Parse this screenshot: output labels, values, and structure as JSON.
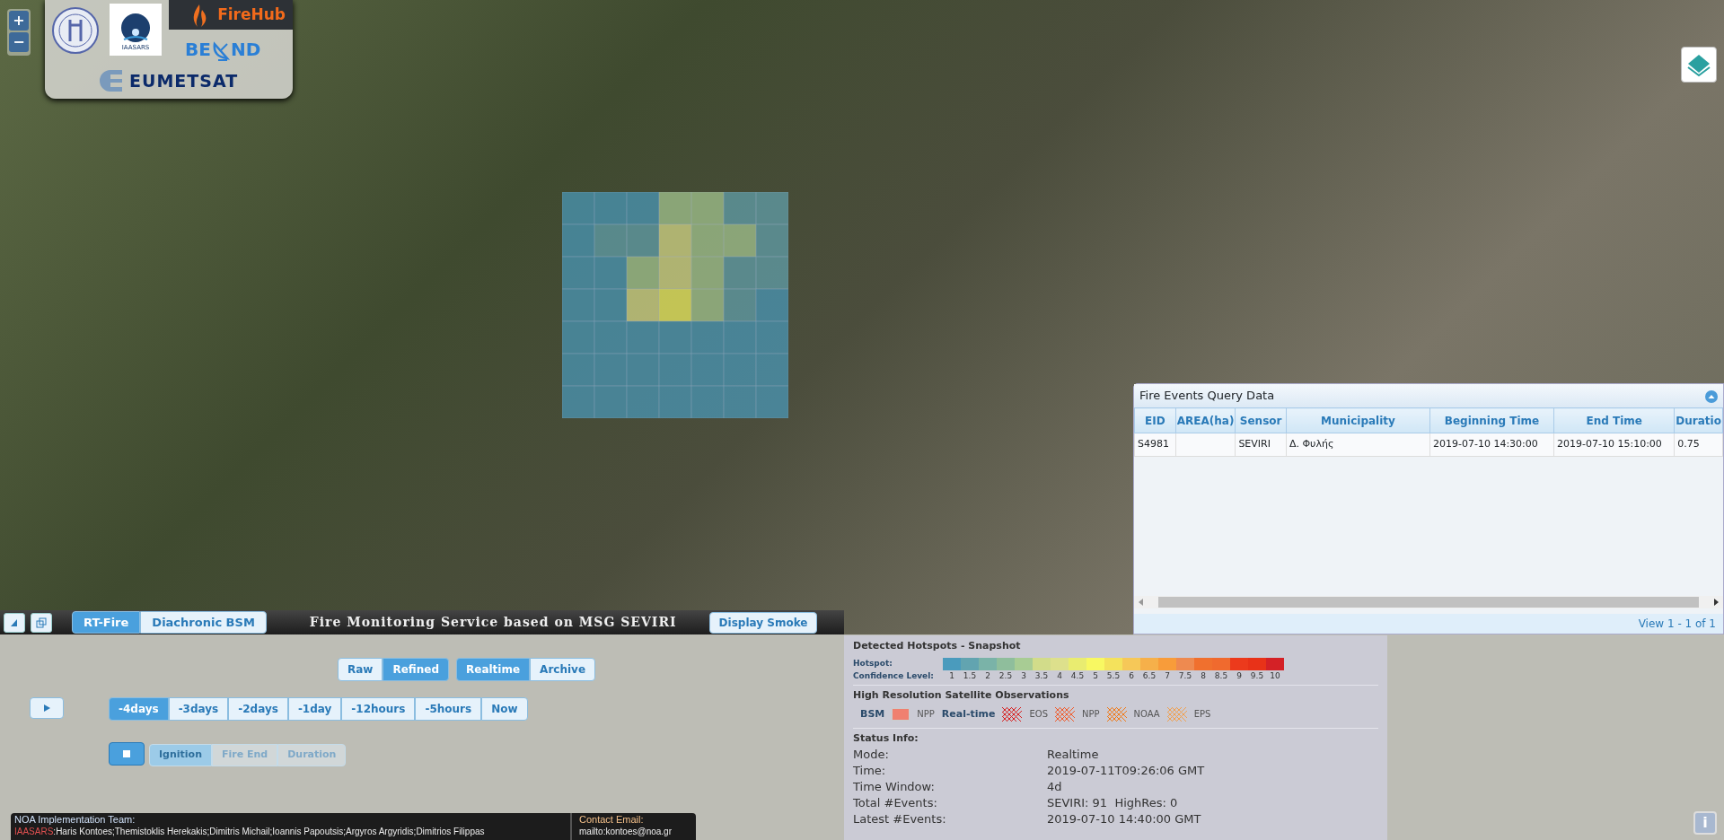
{
  "map_controls": {
    "zoom_in": "+",
    "zoom_out": "−"
  },
  "logos": {
    "iaasars": "IAASARS",
    "firehub": "FireHub",
    "beyond_left": "BE",
    "beyond_right": "ND",
    "eumetsat": "EUMETSAT"
  },
  "mode_tabs": [
    {
      "label": "RT-Fire",
      "selected": true
    },
    {
      "label": "Diachronic BSM",
      "selected": false
    }
  ],
  "banner": "Fire Monitoring Service based on MSG SEVIRI",
  "smoke_button": "Display Smoke",
  "query_panel": {
    "title": "Fire Events Query Data",
    "columns": [
      "EID",
      "AREA(ha)",
      "Sensor",
      "Municipality",
      "Beginning Time",
      "End Time",
      "Duratio"
    ],
    "rows": [
      [
        "S4981",
        "",
        "SEVIRI",
        "Δ. Φυλής",
        "2019-07-10 14:30:00",
        "2019-07-10 15:10:00",
        "0.75"
      ]
    ],
    "pager": "View 1 - 1 of 1"
  },
  "data_toggle": [
    {
      "label": "Raw",
      "selected": false
    },
    {
      "label": "Refined",
      "selected": true
    }
  ],
  "time_toggle": [
    {
      "label": "Realtime",
      "selected": true
    },
    {
      "label": "Archive",
      "selected": false
    }
  ],
  "time_ranges": [
    {
      "label": "-4days",
      "selected": true
    },
    {
      "label": "-3days",
      "selected": false
    },
    {
      "label": "-2days",
      "selected": false
    },
    {
      "label": "-1day",
      "selected": false
    },
    {
      "label": "-12hours",
      "selected": false
    },
    {
      "label": "-5hours",
      "selected": false
    },
    {
      "label": "Now",
      "selected": false
    }
  ],
  "sort_buttons": [
    {
      "label": "Ignition",
      "selected": true
    },
    {
      "label": "Fire End",
      "selected": false
    },
    {
      "label": "Duration",
      "selected": false
    }
  ],
  "legend": {
    "title": "Detected Hotspots - Snapshot",
    "hotspot_label": "Hotspot:",
    "confidence_label": "Confidence Level:",
    "scale": [
      {
        "label": "1",
        "color": "#4a9bbd"
      },
      {
        "label": "1.5",
        "color": "#62a4b0"
      },
      {
        "label": "2",
        "color": "#7ab3a8"
      },
      {
        "label": "2.5",
        "color": "#8fbe9c"
      },
      {
        "label": "3",
        "color": "#a8cc94"
      },
      {
        "label": "3.5",
        "color": "#d2dc8a"
      },
      {
        "label": "4",
        "color": "#dde08c"
      },
      {
        "label": "4.5",
        "color": "#e9ec70"
      },
      {
        "label": "5",
        "color": "#f8f862"
      },
      {
        "label": "5.5",
        "color": "#f4e25c"
      },
      {
        "label": "6",
        "color": "#f6c858"
      },
      {
        "label": "6.5",
        "color": "#f6b04a"
      },
      {
        "label": "7",
        "color": "#f89c3a"
      },
      {
        "label": "7.5",
        "color": "#ee8a50"
      },
      {
        "label": "8",
        "color": "#f0702e"
      },
      {
        "label": "8.5",
        "color": "#f06a2e"
      },
      {
        "label": "9",
        "color": "#ec3a1c"
      },
      {
        "label": "9.5",
        "color": "#e83218"
      },
      {
        "label": "10",
        "color": "#d42126"
      }
    ]
  },
  "observations": {
    "title": "High Resolution Satellite Observations",
    "items": [
      {
        "kind": "heading",
        "label": "BSM"
      },
      {
        "kind": "solid",
        "color": "#f08070"
      },
      {
        "kind": "text",
        "label": "NPP"
      },
      {
        "kind": "heading",
        "label": "Real-time"
      },
      {
        "kind": "hatch",
        "color": "#d82020"
      },
      {
        "kind": "text",
        "label": "EOS"
      },
      {
        "kind": "hatch",
        "color": "#f05a2a"
      },
      {
        "kind": "text",
        "label": "NPP"
      },
      {
        "kind": "hatch",
        "color": "#f07a18"
      },
      {
        "kind": "text",
        "label": "NOAA"
      },
      {
        "kind": "hatch",
        "color": "#f0a050"
      },
      {
        "kind": "text",
        "label": "EPS"
      }
    ]
  },
  "status": {
    "title": "Status Info:",
    "rows": [
      [
        "Mode:",
        "Realtime"
      ],
      [
        "Time:",
        "2019-07-11T09:26:06 GMT"
      ],
      [
        "Time Window:",
        "4d"
      ],
      [
        "Total #Events:",
        "SEVIRI: 91  HighRes: 0"
      ],
      [
        "Latest #Events:",
        "2019-07-10 14:40:00 GMT"
      ]
    ]
  },
  "footer": {
    "team_title": "NOA Implementation Team:",
    "team_prefix": "IAASARS",
    "team_members": ":Haris Kontoes;Themistoklis Herekakis;Dimitris Michail;Ioannis Papoutsis;Argyros Argyridis;Dimitrios Filippas",
    "contact_title": "Contact Email:",
    "contact_email": "mailto:kontoes@noa.gr"
  },
  "info_button": "i"
}
